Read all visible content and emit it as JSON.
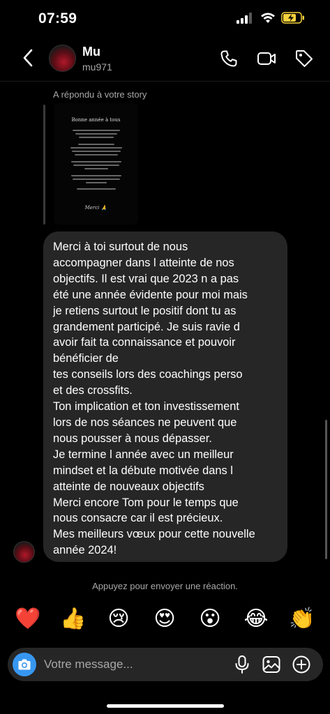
{
  "status": {
    "time": "07:59"
  },
  "header": {
    "name": "Mu",
    "handle": "mu971"
  },
  "thread": {
    "reply_note": "A répondu à votre story",
    "story": {
      "title": "Bonne année à tous",
      "signature": "Merci 🙏"
    },
    "message_lines": [
      "Merci à toi surtout de nous",
      "accompagner dans l atteinte de nos",
      "objectifs. Il est vrai que 2023 n a pas",
      "été une année évidente pour moi mais",
      "je retiens surtout le positif dont tu as",
      "grandement participé. Je suis ravie d",
      "avoir fait ta connaissance et pouvoir",
      "bénéficier de",
      "tes conseils lors des coachings perso",
      "et des crossfits.",
      "Ton implication et ton investissement",
      "lors de nos séances ne peuvent que",
      "nous pousser à nous dépasser.",
      "Je termine l année avec un meilleur",
      "mindset et la débute motivée dans l",
      "atteinte de nouveaux objectifs",
      "Merci encore Tom pour le temps que",
      "nous consacre car il est précieux.",
      "Mes meilleurs vœux pour cette nouvelle",
      "année 2024!"
    ]
  },
  "reactions": {
    "hint": "Appuyez pour envoyer une réaction.",
    "items": [
      "❤️",
      "👍",
      "😢",
      "😍",
      "😮",
      "😂",
      "👏"
    ]
  },
  "composer": {
    "placeholder": "Votre message..."
  },
  "icons": {
    "back": "chevron-left-icon",
    "call": "phone-icon",
    "video": "video-camera-icon",
    "tag": "tag-icon",
    "camera": "camera-icon",
    "mic": "microphone-icon",
    "gallery": "image-icon",
    "add": "plus-circle-icon"
  },
  "colors": {
    "background": "#000000",
    "bubble": "#262626",
    "accent": "#3797f0",
    "battery": "#f7d13c"
  }
}
